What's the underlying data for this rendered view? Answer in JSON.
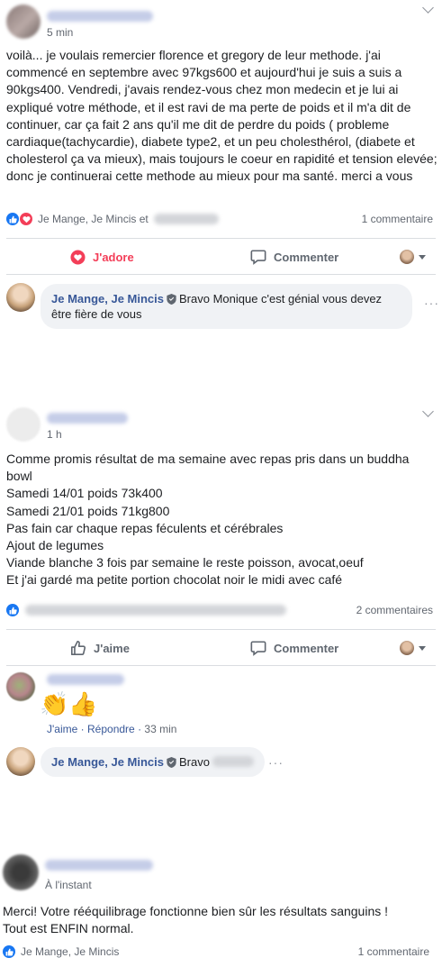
{
  "post1": {
    "time": "5 min",
    "text": "voilà... je voulais remercier florence et gregory de leur methode. j'ai commencé en septembre avec 97kgs600 et aujourd'hui je suis a suis a 90kgs400. Vendredi, j'avais rendez-vous chez mon medecin et je lui ai expliqué votre méthode, et il est ravi de ma perte de poids et il m'a dit de continuer, car ça fait 2 ans qu'il me dit de perdre du poids ( probleme cardiaque(tachycardie), diabete type2, et un peu cholesthérol, (diabete et cholesterol ça va mieux), mais toujours le coeur en rapidité et tension elevée; donc je continuerai cette methode au mieux pour ma santé. merci a vous",
    "reactions_text": "Je Mange, Je Mincis et",
    "comments_count": "1 commentaire",
    "action_love": "J'adore",
    "action_comment": "Commenter",
    "comment": {
      "author": "Je Mange, Je Mincis",
      "text": "Bravo Monique c'est génial vous devez être fière de vous"
    }
  },
  "post2": {
    "time": "1 h",
    "text": "Comme promis résultat de ma semaine avec repas pris dans un buddha bowl\nSamedi 14/01 poids 73k400\nSamedi 21/01 poids 71kg800\nPas fain car chaque repas féculents et cérébrales\nAjout de legumes\nViande blanche 3 fois par semaine le reste poisson, avocat,oeuf\nEt j'ai gardé ma petite portion chocolat noir le midi avec café",
    "comments_count": "2 commentaires",
    "action_like": "J'aime",
    "action_comment": "Commenter",
    "reply": {
      "emoji": "👏👍",
      "like_link": "J'aime",
      "reply_link": "Répondre",
      "time": "33 min"
    },
    "comment": {
      "author": "Je Mange, Je Mincis",
      "text": "Bravo"
    }
  },
  "post3": {
    "time": "À l'instant",
    "text": "Merci! Votre rééquilibrage fonctionne bien sûr les résultats sanguins !\nTout est ENFIN normal.",
    "reactions_text": "Je Mange, Je Mincis",
    "comments_count": "1 commentaire"
  },
  "icons": {
    "like": "thumbs-up-icon",
    "love": "heart-icon",
    "comment": "speech-bubble-icon",
    "verified": "shield-check-icon",
    "menu": "chevron-down-icon"
  },
  "colors": {
    "facebook_blue": "#1877f2",
    "love_red": "#f33e58",
    "author_blue": "#385898",
    "muted": "#616770"
  }
}
